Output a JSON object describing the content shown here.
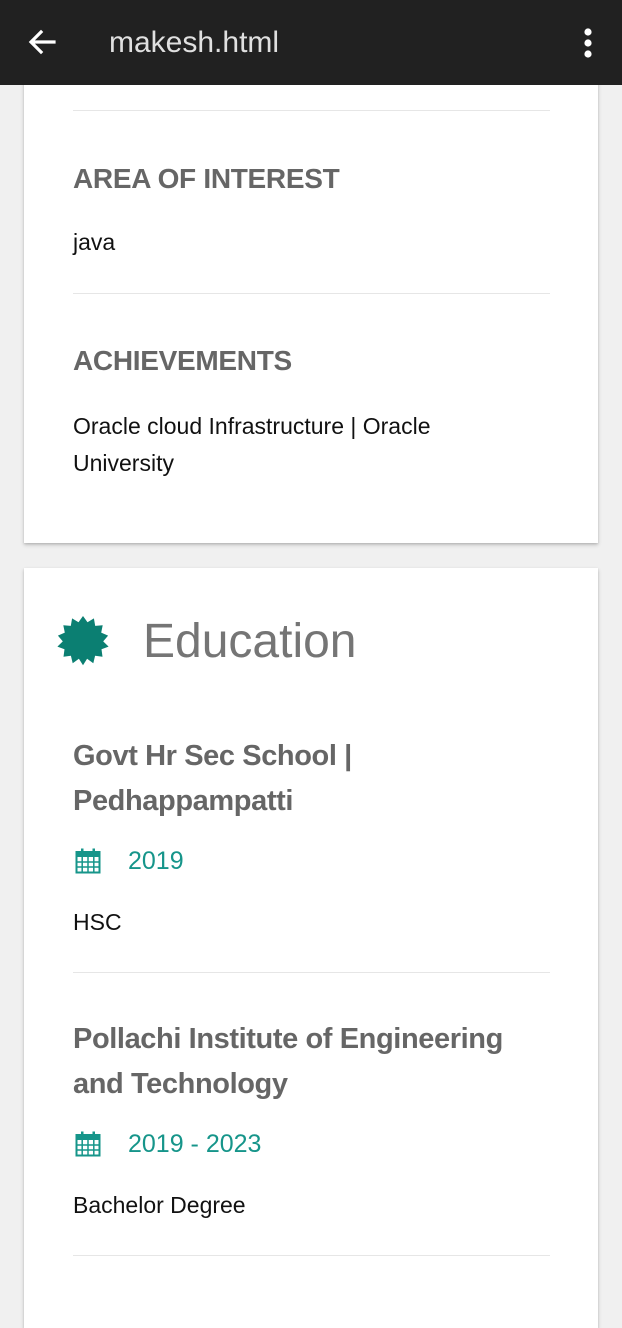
{
  "app_bar": {
    "title": "makesh.html",
    "back_icon": "arrow-left-icon",
    "menu_icon": "more-vert-icon",
    "background": "#212121"
  },
  "sections": {
    "area_of_interest": {
      "heading": "AREA OF INTEREST",
      "text": "java"
    },
    "achievements": {
      "heading": "ACHIEVEMENTS",
      "text": "Oracle cloud Infrastructure | Oracle University"
    }
  },
  "education": {
    "title": "Education",
    "icon": "badge-icon",
    "accent_color": "#16958a",
    "items": [
      {
        "school": "Govt Hr Sec School | Pedhappampatti",
        "date": "2019",
        "degree": "HSC"
      },
      {
        "school": "Pollachi Institute of Engineering and Technology",
        "date": "2019 - 2023",
        "degree": "Bachelor Degree"
      }
    ]
  }
}
